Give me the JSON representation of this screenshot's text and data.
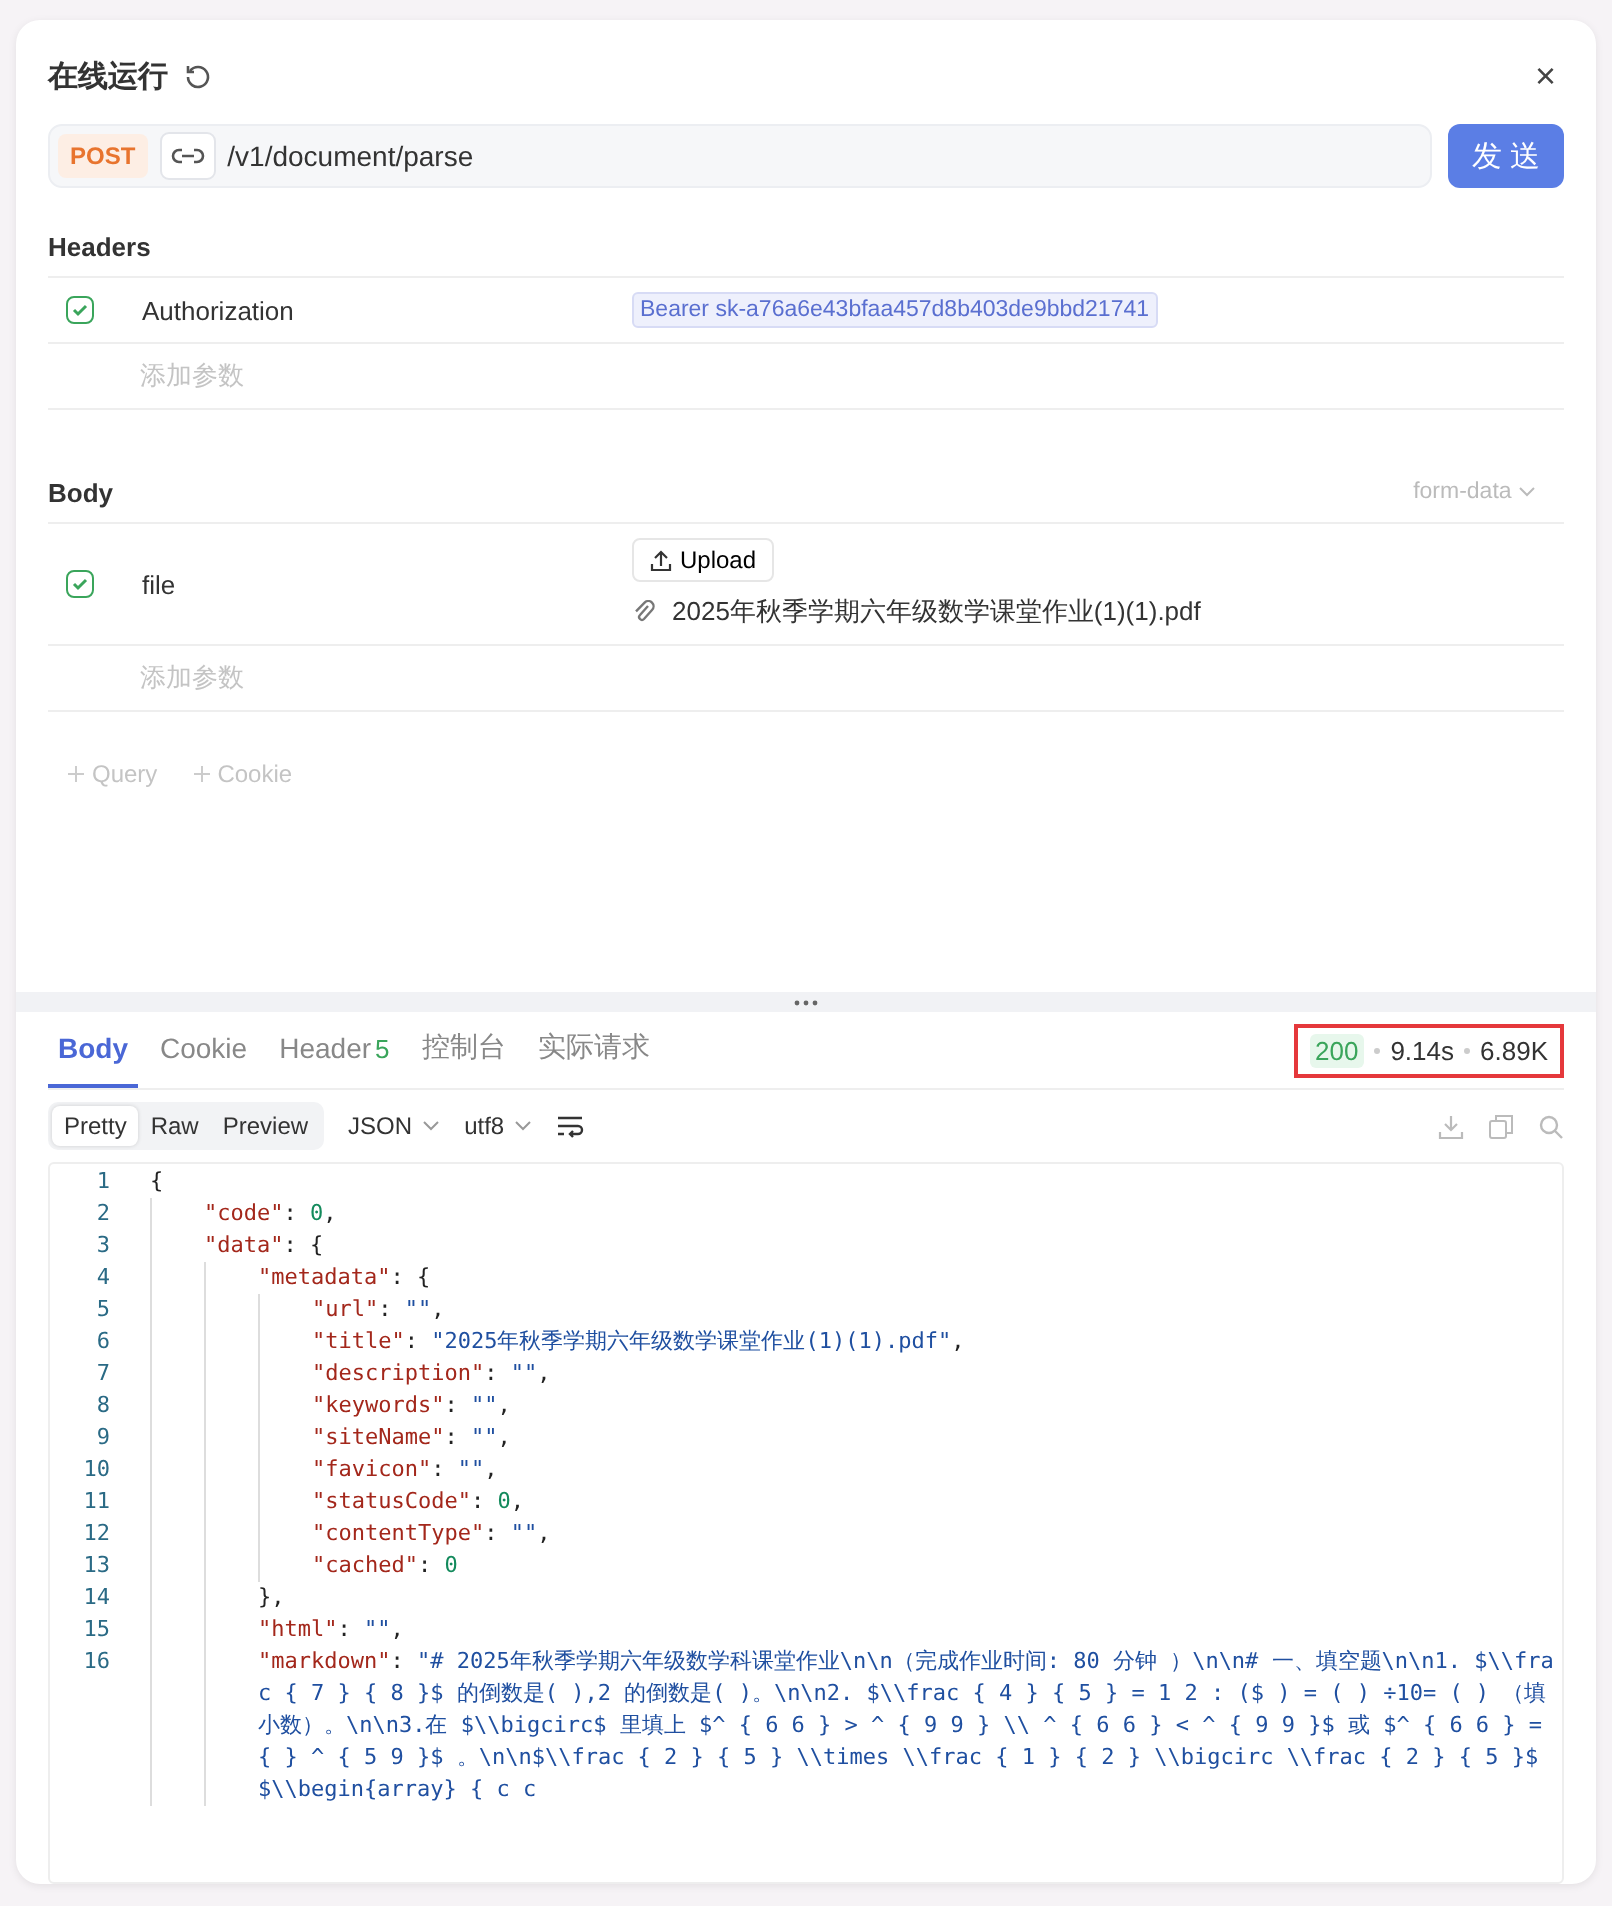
{
  "panel": {
    "title": "在线运行",
    "close": "×"
  },
  "request": {
    "method": "POST",
    "url": "/v1/document/parse",
    "send": "发 送"
  },
  "headers": {
    "title": "Headers",
    "params": [
      {
        "checked": true,
        "name": "Authorization",
        "value": "Bearer sk-a76a6e43bfaa457d8b403de9bbd21741"
      }
    ],
    "add_placeholder": "添加参数"
  },
  "body": {
    "title": "Body",
    "format": "form-data",
    "params": [
      {
        "checked": true,
        "name": "file",
        "upload": "Upload",
        "filename": "2025年秋季学期六年级数学课堂作业(1)(1).pdf"
      }
    ],
    "add_placeholder": "添加参数"
  },
  "extras": [
    "Query",
    "Cookie"
  ],
  "response": {
    "tabs": [
      {
        "label": "Body",
        "selected": true
      },
      {
        "label": "Cookie",
        "selected": false
      },
      {
        "label": "Header",
        "badge": "5",
        "selected": false
      },
      {
        "label": "控制台",
        "selected": false
      },
      {
        "label": "实际请求",
        "selected": false
      }
    ],
    "status": "200",
    "time": "9.14s",
    "size": "6.89K",
    "views": [
      {
        "label": "Pretty",
        "selected": true
      },
      {
        "label": "Raw",
        "selected": false
      },
      {
        "label": "Preview",
        "selected": false
      }
    ],
    "format": "JSON",
    "encoding": "utf8",
    "code": [
      {
        "num": "1",
        "parts": [
          {
            "kind": "punct",
            "text": "{"
          }
        ],
        "children": [
          {
            "num": "2",
            "parts": [
              {
                "kind": "key",
                "text": "\"code\""
              },
              {
                "kind": "punct",
                "text": ": "
              },
              {
                "kind": "number",
                "text": "0"
              },
              {
                "kind": "punct",
                "text": ","
              }
            ]
          },
          {
            "num": "3",
            "parts": [
              {
                "kind": "key",
                "text": "\"data\""
              },
              {
                "kind": "punct",
                "text": ": {"
              }
            ],
            "children": [
              {
                "num": "4",
                "parts": [
                  {
                    "kind": "key",
                    "text": "\"metadata\""
                  },
                  {
                    "kind": "punct",
                    "text": ": {"
                  }
                ],
                "children": [
                  {
                    "num": "5",
                    "parts": [
                      {
                        "kind": "key",
                        "text": "\"url\""
                      },
                      {
                        "kind": "punct",
                        "text": ": "
                      },
                      {
                        "kind": "string",
                        "text": "\"\""
                      },
                      {
                        "kind": "punct",
                        "text": ","
                      }
                    ]
                  },
                  {
                    "num": "6",
                    "parts": [
                      {
                        "kind": "key",
                        "text": "\"title\""
                      },
                      {
                        "kind": "punct",
                        "text": ": "
                      },
                      {
                        "kind": "string",
                        "text": "\"2025年秋季学期六年级数学课堂作业(1)(1).pdf\""
                      },
                      {
                        "kind": "punct",
                        "text": ","
                      }
                    ]
                  },
                  {
                    "num": "7",
                    "parts": [
                      {
                        "kind": "key",
                        "text": "\"description\""
                      },
                      {
                        "kind": "punct",
                        "text": ": "
                      },
                      {
                        "kind": "string",
                        "text": "\"\""
                      },
                      {
                        "kind": "punct",
                        "text": ","
                      }
                    ]
                  },
                  {
                    "num": "8",
                    "parts": [
                      {
                        "kind": "key",
                        "text": "\"keywords\""
                      },
                      {
                        "kind": "punct",
                        "text": ": "
                      },
                      {
                        "kind": "string",
                        "text": "\"\""
                      },
                      {
                        "kind": "punct",
                        "text": ","
                      }
                    ]
                  },
                  {
                    "num": "9",
                    "parts": [
                      {
                        "kind": "key",
                        "text": "\"siteName\""
                      },
                      {
                        "kind": "punct",
                        "text": ": "
                      },
                      {
                        "kind": "string",
                        "text": "\"\""
                      },
                      {
                        "kind": "punct",
                        "text": ","
                      }
                    ]
                  },
                  {
                    "num": "10",
                    "parts": [
                      {
                        "kind": "key",
                        "text": "\"favicon\""
                      },
                      {
                        "kind": "punct",
                        "text": ": "
                      },
                      {
                        "kind": "string",
                        "text": "\"\""
                      },
                      {
                        "kind": "punct",
                        "text": ","
                      }
                    ]
                  },
                  {
                    "num": "11",
                    "parts": [
                      {
                        "kind": "key",
                        "text": "\"statusCode\""
                      },
                      {
                        "kind": "punct",
                        "text": ": "
                      },
                      {
                        "kind": "number",
                        "text": "0"
                      },
                      {
                        "kind": "punct",
                        "text": ","
                      }
                    ]
                  },
                  {
                    "num": "12",
                    "parts": [
                      {
                        "kind": "key",
                        "text": "\"contentType\""
                      },
                      {
                        "kind": "punct",
                        "text": ": "
                      },
                      {
                        "kind": "string",
                        "text": "\"\""
                      },
                      {
                        "kind": "punct",
                        "text": ","
                      }
                    ]
                  },
                  {
                    "num": "13",
                    "parts": [
                      {
                        "kind": "key",
                        "text": "\"cached\""
                      },
                      {
                        "kind": "punct",
                        "text": ": "
                      },
                      {
                        "kind": "number",
                        "text": "0"
                      }
                    ]
                  }
                ]
              },
              {
                "num": "14",
                "parts": [
                  {
                    "kind": "punct",
                    "text": "},"
                  }
                ]
              },
              {
                "num": "15",
                "parts": [
                  {
                    "kind": "key",
                    "text": "\"html\""
                  },
                  {
                    "kind": "punct",
                    "text": ": "
                  },
                  {
                    "kind": "string",
                    "text": "\"\""
                  },
                  {
                    "kind": "punct",
                    "text": ","
                  }
                ]
              },
              {
                "num": "16",
                "parts": [
                  {
                    "kind": "key",
                    "text": "\"markdown\""
                  },
                  {
                    "kind": "punct",
                    "text": ": "
                  },
                  {
                    "kind": "string",
                    "text": "\"# 2025年秋季学期六年级数学科课堂作业\\n\\n（完成作业时间: 80 分钟 ）\\n\\n# 一、填空题\\n\\n1. $\\\\frac { 7 } { 8 }$ 的倒数是( ),2 的倒数是( )。\\n\\n2. $\\\\frac { 4 } { 5 } = 1 2 : ($ ) = ( ) ÷10= ( ) （填小数）。\\n\\n3.在 $\\\\bigcirc$ 里填上 $^ { 6 6 } > ^ { 9 9 } \\\\ ^ { 6 6 } < ^ { 9 9 }$ 或 $^ { 6 6 } = { } ^ { 5 9 }$ 。\\n\\n$\\\\frac { 2 } { 5 } \\\\times \\\\frac { 1 } { 2 } \\\\bigcirc \\\\frac { 2 } { 5 }$ $\\\\begin{array} { c c"
                  }
                ]
              }
            ]
          }
        ]
      }
    ]
  }
}
